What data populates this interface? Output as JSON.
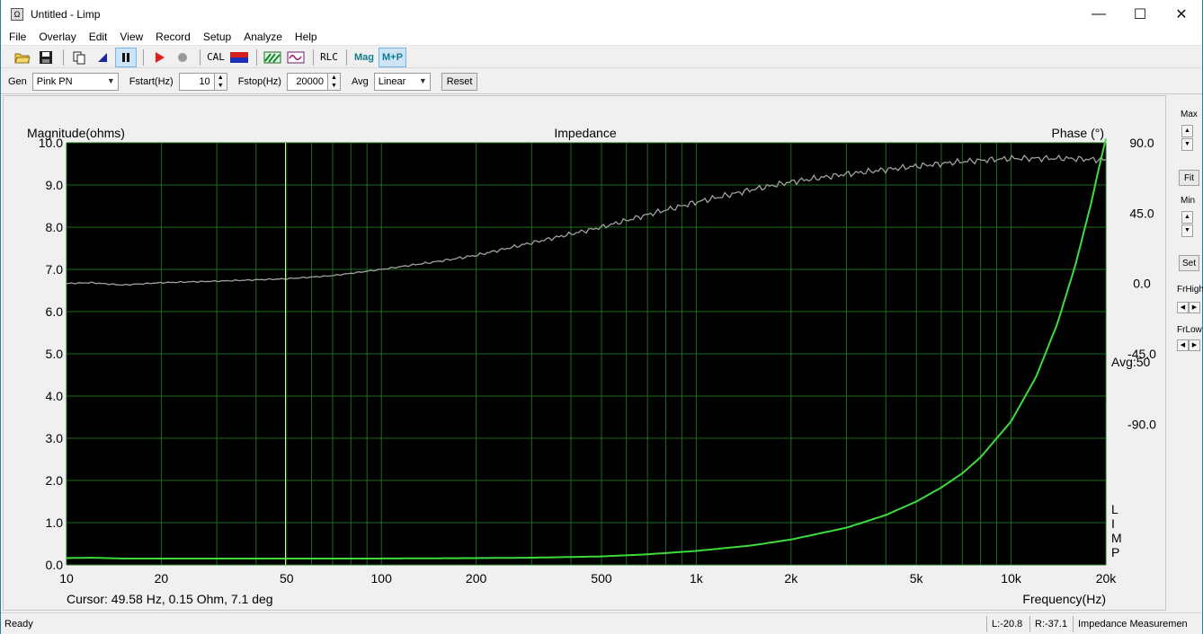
{
  "window": {
    "title": "Untitled - Limp",
    "app_icon_glyph": "Ω",
    "controls": {
      "minimize": "—",
      "maximize": "☐",
      "close": "✕"
    }
  },
  "menu": [
    "File",
    "Overlay",
    "Edit",
    "View",
    "Record",
    "Setup",
    "Analyze",
    "Help"
  ],
  "toolbar": {
    "cal_label": "CAL",
    "rlc_label": "RLC",
    "mag_label": "Mag",
    "mp_label": "M+P"
  },
  "options": {
    "gen_label": "Gen",
    "gen_value": "Pink PN",
    "fstart_label": "Fstart(Hz)",
    "fstart_value": "10",
    "fstop_label": "Fstop(Hz)",
    "fstop_value": "20000",
    "avg_label": "Avg",
    "avg_value": "Linear",
    "reset_label": "Reset"
  },
  "chart_data": {
    "type": "line",
    "title": "Impedance",
    "ylabel": "Magnitude(ohms)",
    "y2label": "Phase (°)",
    "xlabel": "Frequency(Hz)",
    "xscale": "log",
    "xlim": [
      10,
      20000
    ],
    "ylim": [
      0,
      10
    ],
    "y2lim": [
      -180,
      90
    ],
    "x_tick_labels": [
      "10",
      "20",
      "50",
      "100",
      "200",
      "500",
      "1k",
      "2k",
      "5k",
      "10k",
      "20k"
    ],
    "x_tick_values": [
      10,
      20,
      50,
      100,
      200,
      500,
      1000,
      2000,
      5000,
      10000,
      20000
    ],
    "y_tick_labels": [
      "10.0",
      "9.0",
      "8.0",
      "7.0",
      "6.0",
      "5.0",
      "4.0",
      "3.0",
      "2.0",
      "1.0",
      "0.0"
    ],
    "y_tick_values": [
      10,
      9,
      8,
      7,
      6,
      5,
      4,
      3,
      2,
      1,
      0
    ],
    "y2_tick_labels": [
      "90.0",
      "45.0",
      "0.0",
      "-45.0",
      "-90.0"
    ],
    "y2_tick_values": [
      90,
      45,
      0,
      -45,
      -90
    ],
    "avg_text": "Avg:50",
    "side_text": [
      "L",
      "I",
      "M",
      "P"
    ],
    "cursor_text": "Cursor: 49.58 Hz, 0.15 Ohm, 7.1 deg",
    "cursor_freq": 49.58,
    "grid": true,
    "background": "#000000",
    "grid_color": "#1f6b1f",
    "series": [
      {
        "name": "Magnitude",
        "axis": "left",
        "color": "#3ddc3d",
        "x": [
          10,
          12,
          15,
          20,
          30,
          50,
          100,
          200,
          300,
          500,
          700,
          1000,
          1500,
          2000,
          3000,
          4000,
          5000,
          6000,
          7000,
          8000,
          10000,
          12000,
          14000,
          16000,
          18000,
          19000,
          20000
        ],
        "y": [
          0.16,
          0.17,
          0.15,
          0.15,
          0.15,
          0.15,
          0.15,
          0.16,
          0.17,
          0.2,
          0.25,
          0.33,
          0.46,
          0.6,
          0.88,
          1.18,
          1.5,
          1.83,
          2.17,
          2.55,
          3.4,
          4.45,
          5.7,
          7.1,
          8.6,
          9.4,
          10.1
        ]
      },
      {
        "name": "Phase",
        "axis": "right",
        "color": "#a0a0a0",
        "x": [
          10,
          12,
          15,
          20,
          30,
          50,
          70,
          100,
          150,
          200,
          300,
          500,
          700,
          1000,
          1500,
          2000,
          3000,
          5000,
          7000,
          10000,
          15000,
          20000
        ],
        "y": [
          0,
          0.5,
          -1,
          0.5,
          1.5,
          3,
          5,
          9,
          14,
          18,
          26,
          36,
          44,
          52,
          60,
          65,
          70,
          75,
          78,
          80,
          80,
          79
        ]
      }
    ]
  },
  "right_panel": {
    "max_label": "Max",
    "fit_label": "Fit",
    "min_label": "Min",
    "set_label": "Set",
    "frhigh_label": "FrHigh",
    "frlow_label": "FrLow"
  },
  "status": {
    "ready": "Ready",
    "left": "L:-20.8",
    "right": "R:-37.1",
    "mode": "Impedance Measuremen"
  }
}
